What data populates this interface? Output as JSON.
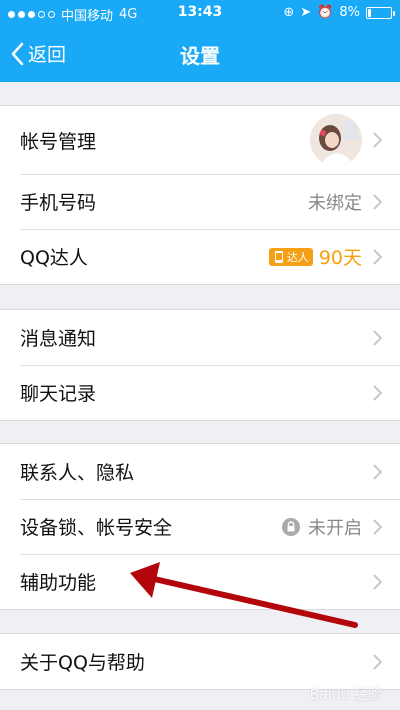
{
  "status_bar": {
    "carrier": "中国移动",
    "network": "4G",
    "time": "13:43",
    "battery_percent": "8%",
    "signal_bars": 3
  },
  "nav": {
    "back_label": "返回",
    "title": "设置"
  },
  "groups": [
    {
      "items": [
        {
          "label": "帐号管理",
          "value": "",
          "has_avatar": true
        },
        {
          "label": "手机号码",
          "value": "未绑定"
        },
        {
          "label": "QQ达人",
          "badge": "达人",
          "value": "90天"
        }
      ]
    },
    {
      "items": [
        {
          "label": "消息通知"
        },
        {
          "label": "聊天记录"
        }
      ]
    },
    {
      "items": [
        {
          "label": "联系人、隐私"
        },
        {
          "label": "设备锁、帐号安全",
          "value": "未开启",
          "has_lock": true
        },
        {
          "label": "辅助功能"
        }
      ]
    },
    {
      "items": [
        {
          "label": "关于QQ与帮助"
        }
      ]
    }
  ],
  "annotation": {
    "arrow_color": "#b3060a"
  },
  "watermark": "Baidu 经验"
}
